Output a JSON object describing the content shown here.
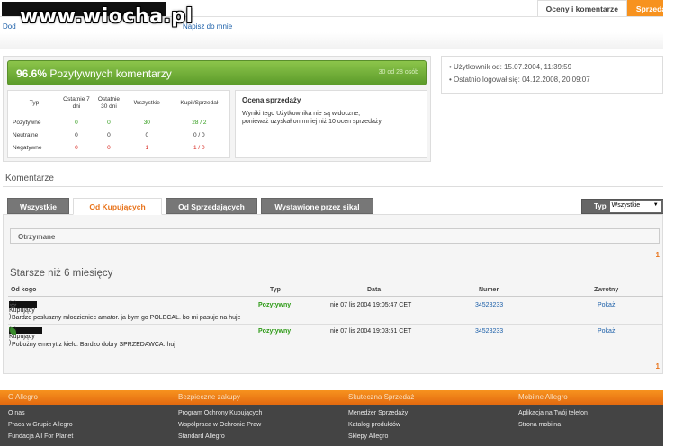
{
  "watermark": "www.wiocha.pl",
  "nav": {
    "link1": "Dod",
    "link2": "Napisz do mnie"
  },
  "top_tabs": [
    "Oceny i komentarze",
    "Sprzeda"
  ],
  "rating": {
    "percent": "96.6%",
    "label": "Pozytywnych komentarzy",
    "count": "30 od 28 osób"
  },
  "stats": {
    "headers": [
      "Typ",
      "Ostatnie 7 dni",
      "Ostatnie 30 dni",
      "Wszystkie",
      "Kupił/Sprzedał"
    ],
    "rows": [
      {
        "label": "Pozytywne",
        "d7": "0",
        "d30": "0",
        "all": "30",
        "ks": "28 / 2"
      },
      {
        "label": "Neutralne",
        "d7": "0",
        "d30": "0",
        "all": "0",
        "ks": "0 / 0"
      },
      {
        "label": "Negatywne",
        "d7": "0",
        "d30": "0",
        "all": "1",
        "ks": "1 / 0"
      }
    ]
  },
  "sales": {
    "title": "Ocena sprzedaży",
    "line1": "Wyniki tego Użytkownika nie są widoczne,",
    "line2": "ponieważ uzyskał on mniej niż 10 ocen sprzedaży."
  },
  "user": {
    "since": "Użytkownik od: 15.07.2004, 11:39:59",
    "last": "Ostatnio logował się: 04.12.2008, 20:09:07"
  },
  "comments": {
    "title": "Komentarze",
    "tabs": [
      "Wszystkie",
      "Od Kupujących",
      "Od Sprzedających",
      "Wystawione przez sikal"
    ],
    "type_label": "Typ",
    "type_value": "Wszystkie",
    "received": "Otrzymane",
    "page": "1",
    "older": "Starsze niż 6 miesięcy",
    "columns": [
      "Od kogo",
      "Typ",
      "Data",
      "Numer",
      "Zwrotny"
    ],
    "rows": [
      {
        "score": "(7)",
        "role": "( Kupujący )",
        "type": "Pozytywny",
        "date": "nie 07 lis 2004 19:05:47 CET",
        "number": "34528233",
        "ret": "Pokaż",
        "text": "Bardzo posłuszny młodzieniec amator. ja bym go POLECAŁ. bo mi pasuje na huje"
      },
      {
        "score": "(1)",
        "role": "( Kupujący )",
        "type": "Pozytywny",
        "date": "nie 07 lis 2004 19:03:51 CET",
        "number": "34528233",
        "ret": "Pokaż",
        "text": "Pobożny emeryt z kielc. Bardzo dobry SPRZEDAWCA. huj"
      }
    ]
  },
  "footer": {
    "cols": [
      {
        "title": "O Allegro",
        "links": [
          "O nas",
          "Praca w Grupie Allegro",
          "Fundacja All For Planet"
        ]
      },
      {
        "title": "Bezpieczne zakupy",
        "links": [
          "Program Ochrony Kupujących",
          "Współpraca w Ochronie Praw",
          "Standard Allegro"
        ]
      },
      {
        "title": "Skuteczna Sprzedaż",
        "links": [
          "Menedżer Sprzedaży",
          "Katalog produktów",
          "Sklepy Allegro"
        ]
      },
      {
        "title": "Mobilne Allegro",
        "links": [
          "Aplikacja na Twój telefon",
          "Strona mobilna"
        ]
      }
    ]
  },
  "colors": {
    "orange": "#f7921e",
    "green": "#5c9b2a",
    "positive": "#2d9a16",
    "negative": "#d7231b"
  }
}
